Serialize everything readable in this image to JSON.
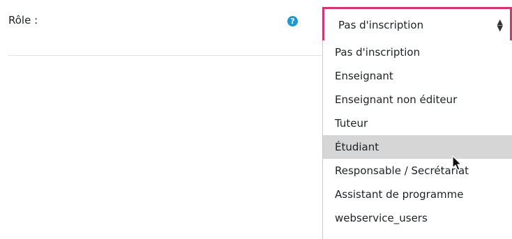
{
  "field": {
    "label": "Rôle :",
    "help_icon": "question-circle-icon",
    "help_glyph": "?"
  },
  "select": {
    "selected": "Pas d'inscription",
    "arrow_icon": "sort-arrows-icon",
    "accent_color": "#d43471"
  },
  "dropdown": {
    "hover_color": "#d6d6d6",
    "hovered_index": 4,
    "options": [
      "Pas d'inscription",
      "Enseignant",
      "Enseignant non éditeur",
      "Tuteur",
      "Étudiant",
      "Responsable / Secrétariat",
      "Assistant de programme",
      "webservice_users"
    ]
  },
  "cursor": {
    "icon": "mouse-pointer-icon"
  }
}
